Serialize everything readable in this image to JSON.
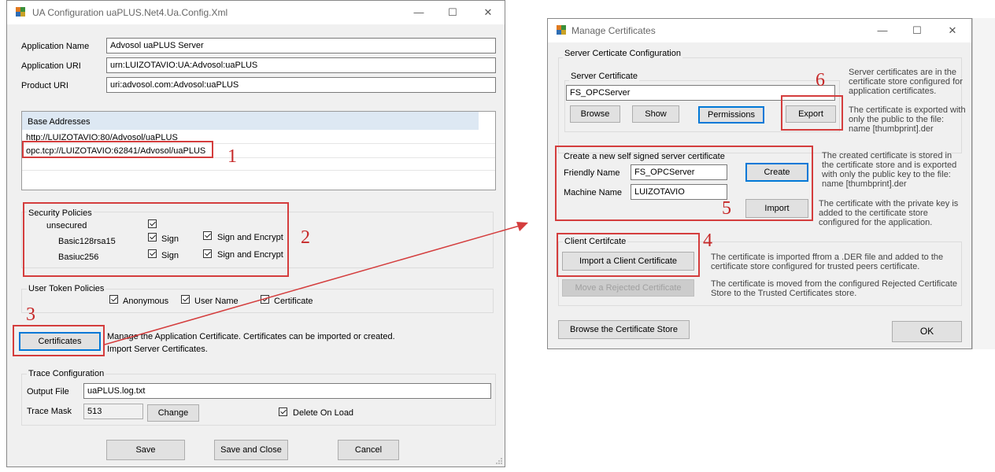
{
  "ua_config": {
    "title": "UA Configuration   uaPLUS.Net4.Ua.Config.Xml",
    "app_icon": "puzzle-app-icon",
    "app_name_label": "Application Name",
    "app_name_value": "Advosol uaPLUS Server",
    "app_uri_label": "Application URI",
    "app_uri_value": "urn:LUIZOTAVIO:UA:Advosol:uaPLUS",
    "product_uri_label": "Product URI",
    "product_uri_value": "uri:advosol.com:Advosol:uaPLUS",
    "base_addresses": {
      "header": "Base Addresses",
      "items": [
        "http://LUIZOTAVIO:80/Advosol/uaPLUS",
        "opc.tcp://LUIZOTAVIO:62841/Advosol/uaPLUS"
      ]
    },
    "security_policies": {
      "title": "Security Policies",
      "rows": [
        {
          "name": "unsecured"
        },
        {
          "name": "Basic128rsa15",
          "sign": "Sign",
          "sign_encrypt": "Sign and Encrypt"
        },
        {
          "name": "Basiuc256",
          "sign": "Sign",
          "sign_encrypt": "Sign and Encrypt"
        }
      ]
    },
    "user_token": {
      "title": "User Token Policies",
      "anonymous": "Anonymous",
      "user_name": "User Name",
      "certificate": "Certificate"
    },
    "certificates_button": "Certificates",
    "certificates_desc_1": "Manage the Application Certificate.  Certificates can be imported or created.",
    "certificates_desc_2": "Import Server Certificates.",
    "trace": {
      "title": "Trace Configuration",
      "output_file_label": "Output File",
      "output_file_value": "uaPLUS.log.txt",
      "trace_mask_label": "Trace Mask",
      "trace_mask_value": "513",
      "change_button": "Change",
      "delete_on_load": "Delete On Load"
    },
    "footer": {
      "save": "Save",
      "save_close": "Save and Close",
      "cancel": "Cancel"
    },
    "window_controls": {
      "minimize": "—",
      "maximize": "☐",
      "close": "✕"
    }
  },
  "manage_certs": {
    "title": "Manage Certificates",
    "app_icon": "puzzle-app-icon",
    "server_config_title": "Server Certicate Configuration",
    "server_cert_title": "Server Certificate",
    "server_cert_value": "FS_OPCServer",
    "browse": "Browse",
    "show": "Show",
    "permissions": "Permissions",
    "export": "Export",
    "server_desc_1": "Server certificates are in the",
    "server_desc_2": "certificate store configured for",
    "server_desc_3": "application certificates.",
    "export_desc_1": "The certificate is exported with",
    "export_desc_2": "only the public to the file:",
    "export_desc_3": "name [thumbprint].der",
    "create_title": "Create a new self signed server certificate",
    "friendly_name_label": "Friendly Name",
    "friendly_name_value": "FS_OPCServer",
    "machine_name_label": "Machine Name",
    "machine_name_value": "LUIZOTAVIO",
    "create": "Create",
    "import": "Import",
    "create_desc_1": "The created certificate is stored in",
    "create_desc_2": "the certificate store and is exported",
    "create_desc_3": "with only the public key to the file:",
    "create_desc_4": "name [thumbprint].der",
    "import_desc_1": "The certificate with the private key is",
    "import_desc_2": "added to the certificate store",
    "import_desc_3": "configured for the application.",
    "client_title": "Client Certifcate",
    "import_client": "Import a Client Certificate",
    "import_client_desc_1": "The certificate is imported ffrom a .DER file and added to the",
    "import_client_desc_2": "certificate store configured for trusted peers certificate.",
    "move_rejected": "Move a Rejected Certificate",
    "move_desc_1": "The certificate is moved from the configured Rejected Certificate",
    "move_desc_2": "Store to the Trusted Certificates store.",
    "browse_store": "Browse the Certificate Store",
    "ok": "OK",
    "window_controls": {
      "minimize": "—",
      "maximize": "☐",
      "close": "✕"
    }
  },
  "annotations": {
    "n1": "1",
    "n2": "2",
    "n3": "3",
    "n4": "4",
    "n5": "5",
    "n6": "6",
    "color": "#d43d3d"
  }
}
